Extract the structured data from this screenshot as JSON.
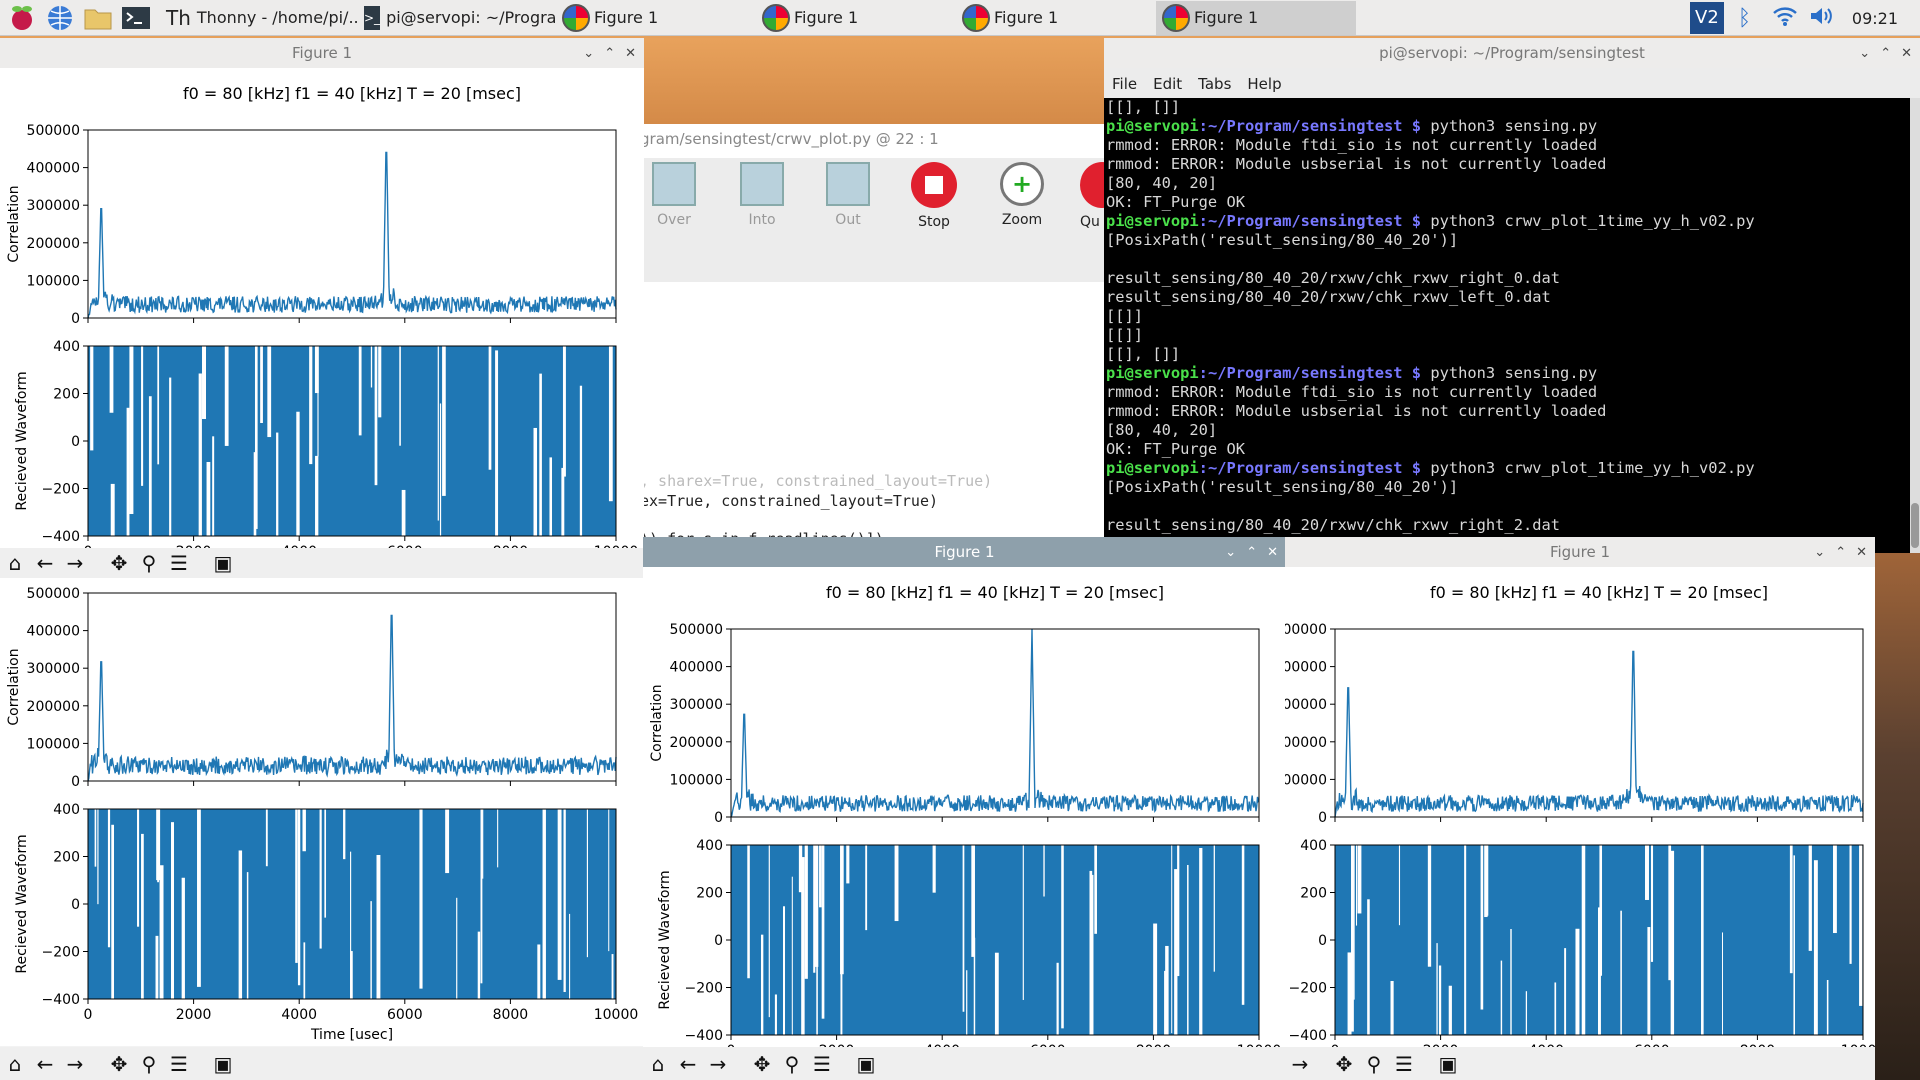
{
  "taskbar": {
    "tasks": [
      "Thonny  -  /home/pi/...",
      "pi@servopi: ~/Progra...",
      "Figure 1",
      "Figure 1",
      "Figure 1",
      "Figure 1"
    ],
    "time": "09:21"
  },
  "thonny": {
    "path": "gram/sensingtest/crwv_plot.py  @  22 : 1",
    "buttons": [
      "Over",
      "Into",
      "Out",
      "Stop",
      "Zoom",
      "Qu"
    ],
    "code": [
      ", sharex=True, constrained_layout=True)",
      "ex=True, constrained_layout=True)",
      ")) for s in f.readlines()])"
    ]
  },
  "terminal": {
    "title": "pi@servopi: ~/Program/sensingtest",
    "menu": [
      "File",
      "Edit",
      "Tabs",
      "Help"
    ],
    "user": "pi@servopi",
    "path": ":~/Program/sensingtest $",
    "lines": [
      {
        "t": "[[], []]"
      },
      {
        "p": true,
        "t": " python3 sensing.py"
      },
      {
        "t": "rmmod: ERROR: Module ftdi_sio is not currently loaded"
      },
      {
        "t": "rmmod: ERROR: Module usbserial is not currently loaded"
      },
      {
        "t": "[80, 40, 20]"
      },
      {
        "t": "OK: FT_Purge OK"
      },
      {
        "p": true,
        "t": " python3 crwv_plot_1time_yy_h_v02.py"
      },
      {
        "t": "[PosixPath('result_sensing/80_40_20')]"
      },
      {
        "t": ""
      },
      {
        "t": "result_sensing/80_40_20/rxwv/chk_rxwv_right_0.dat"
      },
      {
        "t": "result_sensing/80_40_20/rxwv/chk_rxwv_left_0.dat"
      },
      {
        "t": "[[]]"
      },
      {
        "t": "[[]]"
      },
      {
        "t": "[[], []]"
      },
      {
        "p": true,
        "t": " python3 sensing.py"
      },
      {
        "t": "rmmod: ERROR: Module ftdi_sio is not currently loaded"
      },
      {
        "t": "rmmod: ERROR: Module usbserial is not currently loaded"
      },
      {
        "t": "[80, 40, 20]"
      },
      {
        "t": "OK: FT_Purge OK"
      },
      {
        "p": true,
        "t": " python3 crwv_plot_1time_yy_h_v02.py"
      },
      {
        "t": "[PosixPath('result_sensing/80_40_20')]"
      },
      {
        "t": ""
      },
      {
        "t": "result_sensing/80_40_20/rxwv/chk_rxwv_right_2.dat"
      }
    ]
  },
  "figure": {
    "window_title": "Figure 1",
    "suptitle": "f0 = 80 [kHz]  f1 = 40 [kHz]  T = 20 [msec]",
    "top_ylabel": "Correlation",
    "bottom_ylabel": "Recieved Waveform",
    "xlabel": "Time [usec]",
    "top_yticks": [
      "0",
      "100000",
      "200000",
      "300000",
      "400000",
      "500000"
    ],
    "bottom_yticks": [
      "-400",
      "-200",
      "0",
      "200",
      "400"
    ],
    "xticks": [
      "0",
      "2000",
      "4000",
      "6000",
      "8000",
      "10000"
    ]
  },
  "chart_data": [
    {
      "type": "line",
      "panel": "top-left correlation",
      "x_range": [
        0,
        10000
      ],
      "ylim": [
        0,
        500000
      ],
      "peaks": [
        {
          "x": 250,
          "y": 330000
        },
        {
          "x": 5650,
          "y": 500000
        }
      ],
      "baseline": 40000
    },
    {
      "type": "line",
      "panel": "bottom-left correlation",
      "x_range": [
        0,
        10000
      ],
      "ylim": [
        0,
        500000
      ],
      "peaks": [
        {
          "x": 250,
          "y": 360000
        },
        {
          "x": 5750,
          "y": 500000
        }
      ],
      "baseline": 45000
    },
    {
      "type": "line",
      "panel": "bottom-middle correlation",
      "x_range": [
        0,
        10000
      ],
      "ylim": [
        0,
        500000
      ],
      "peaks": [
        {
          "x": 250,
          "y": 310000
        },
        {
          "x": 5700,
          "y": 500000
        }
      ],
      "baseline": 40000
    },
    {
      "type": "line",
      "panel": "bottom-right correlation",
      "x_range": [
        0,
        10000
      ],
      "ylim": [
        0,
        500000
      ],
      "peaks": [
        {
          "x": 250,
          "y": 390000
        },
        {
          "x": 5650,
          "y": 500000
        }
      ],
      "baseline": 40000
    }
  ],
  "colors": {
    "line": "#1f77b4"
  }
}
